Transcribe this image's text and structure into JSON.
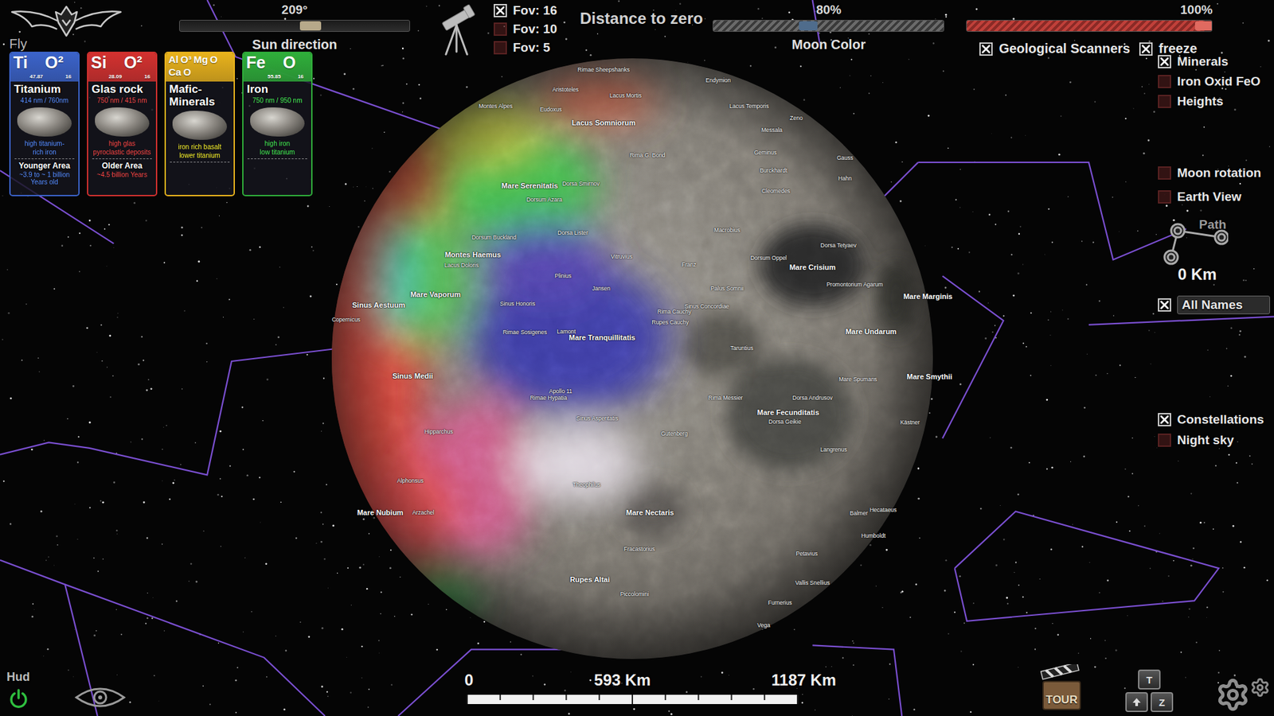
{
  "app": {
    "mode": "Fly"
  },
  "elements": [
    {
      "header": [
        {
          "text": "Ti",
          "kind": "symbol"
        },
        {
          "text": "47.87",
          "kind": "mass"
        },
        {
          "text": "O²",
          "kind": "symbol"
        },
        {
          "text": "16",
          "kind": "mass"
        }
      ],
      "title": "Titanium",
      "bands": "414 nm / 760nm",
      "notes": [
        "high titanium-",
        "rich iron"
      ],
      "age_title": "Younger Area",
      "age": "~3.9 to ~ 1 billion Years old",
      "color": "#3b63c9"
    },
    {
      "header": [
        {
          "text": "Si",
          "kind": "symbol"
        },
        {
          "text": "28.09",
          "kind": "mass"
        },
        {
          "text": "O²",
          "kind": "symbol"
        },
        {
          "text": "16",
          "kind": "mass"
        }
      ],
      "title": "Glas rock",
      "bands": "750 nm / 415 nm",
      "notes": [
        "high glas",
        "pyroclastic deposits"
      ],
      "age_title": "Older Area",
      "age": "~4.5 billion Years",
      "color": "#d3312f"
    },
    {
      "header": [
        {
          "text": "Al",
          "kind": "small"
        },
        {
          "text": "O³",
          "kind": "small"
        },
        {
          "text": "Mg",
          "kind": "small"
        },
        {
          "text": "O",
          "kind": "small"
        },
        {
          "text": "Ca",
          "kind": "small"
        },
        {
          "text": "O",
          "kind": "small"
        }
      ],
      "title": "Mafic-Minerals",
      "bands": "",
      "notes": [
        "iron rich basalt",
        "lower titanium"
      ],
      "age_title": "",
      "age": "",
      "color": "#e8b21c"
    },
    {
      "header": [
        {
          "text": "Fe",
          "kind": "symbol"
        },
        {
          "text": "55.85",
          "kind": "mass"
        },
        {
          "text": "O",
          "kind": "symbol"
        },
        {
          "text": "16",
          "kind": "mass"
        }
      ],
      "title": "Iron",
      "bands": "750 nm / 950 nm",
      "notes": [
        "high iron",
        "low titanium"
      ],
      "age_title": "",
      "age": "",
      "color": "#2fae3a"
    }
  ],
  "sun_slider": {
    "label": "Sun direction",
    "reading": "209°",
    "level": 0.57
  },
  "fov_options": [
    {
      "label": "Fov: 16",
      "selected": true
    },
    {
      "label": "Fov: 10",
      "selected": false
    },
    {
      "label": "Fov: 5",
      "selected": false
    }
  ],
  "distance_button": "Distance to zero",
  "moon_color": {
    "label": "Moon Color",
    "reading": "80%",
    "level": 0.41
  },
  "scanner_slider": {
    "reading": "100%",
    "level": 0.97
  },
  "scanners": [
    {
      "label": "Geological Scanners",
      "checked": true
    },
    {
      "label": "freeze",
      "checked": true
    }
  ],
  "layers": [
    {
      "label": "Minerals",
      "checked": true
    },
    {
      "label": "Iron Oxid FeO",
      "checked": false
    },
    {
      "label": "Heights",
      "checked": false
    }
  ],
  "view_options": [
    {
      "label": "Moon rotation",
      "checked": false
    },
    {
      "label": "Earth View",
      "checked": false
    }
  ],
  "path": {
    "label": "Path",
    "distance": "0 Km"
  },
  "names": {
    "label": "All Names",
    "checked": true
  },
  "sky_options": [
    {
      "label": "Constellations",
      "checked": true
    },
    {
      "label": "Night sky",
      "checked": false
    }
  ],
  "scale": {
    "labels": [
      "0",
      "593 Km",
      "1187 Km"
    ]
  },
  "hud": {
    "label": "Hud",
    "on": true
  },
  "tour": {
    "label": "TOUR"
  },
  "keys": [
    "T",
    "Z"
  ],
  "moon_labels": [
    {
      "text": "Mare Serenitatis",
      "kind": "mare"
    },
    {
      "text": "Mare Crisium",
      "kind": "mare"
    },
    {
      "text": "Mare Tranquillitatis",
      "kind": "mare"
    },
    {
      "text": "Mare Fecunditatis",
      "kind": "mare"
    },
    {
      "text": "Mare Nectaris",
      "kind": "mare"
    },
    {
      "text": "Mare Vaporum",
      "kind": "mare"
    },
    {
      "text": "Mare Nubium",
      "kind": "mare"
    },
    {
      "text": "Mare Marginis",
      "kind": "mare"
    },
    {
      "text": "Mare Smythii",
      "kind": "mare"
    },
    {
      "text": "Mare Undarum",
      "kind": "mare"
    },
    {
      "text": "Mare Spumans",
      "kind": "feature"
    },
    {
      "text": "Sinus Medii",
      "kind": "mare"
    },
    {
      "text": "Sinus Aestuum",
      "kind": "mare"
    },
    {
      "text": "Sinus Asperitatis",
      "kind": "feature"
    },
    {
      "text": "Sinus Concordiae",
      "kind": "feature"
    },
    {
      "text": "Lacus Somniorum",
      "kind": "mare"
    },
    {
      "text": "Montes Haemus",
      "kind": "mare"
    },
    {
      "text": "Rupes Altai",
      "kind": "mare"
    },
    {
      "text": "Copernicus",
      "kind": "feature"
    },
    {
      "text": "Lamont",
      "kind": "feature"
    },
    {
      "text": "Jansen",
      "kind": "feature"
    },
    {
      "text": "Dorsa Smirnov",
      "kind": "feature"
    },
    {
      "text": "Dorsum Azara",
      "kind": "feature"
    },
    {
      "text": "Rimae Sosigenes",
      "kind": "feature"
    },
    {
      "text": "Rimae Hypatia",
      "kind": "feature"
    },
    {
      "text": "Rima Messier",
      "kind": "feature"
    },
    {
      "text": "Dorsa Geikie",
      "kind": "feature"
    },
    {
      "text": "Dorsa Andrusov",
      "kind": "feature"
    },
    {
      "text": "Dorsum Oppel",
      "kind": "feature"
    },
    {
      "text": "Dorsa Tetyaev",
      "kind": "feature"
    },
    {
      "text": "Promontorium Agarum",
      "kind": "feature"
    },
    {
      "text": "Palus Somnii",
      "kind": "feature"
    },
    {
      "text": "Montes Alpes",
      "kind": "feature"
    },
    {
      "text": "Rima Cauchy",
      "kind": "feature"
    },
    {
      "text": "Rupes Cauchy",
      "kind": "feature"
    },
    {
      "text": "Lacus Temporis",
      "kind": "feature"
    },
    {
      "text": "Endymion",
      "kind": "feature"
    },
    {
      "text": "Rimae Sheepshanks",
      "kind": "feature"
    },
    {
      "text": "Aristoteles",
      "kind": "feature"
    },
    {
      "text": "Eudoxus",
      "kind": "feature"
    },
    {
      "text": "Lacus Mortis",
      "kind": "feature"
    },
    {
      "text": "Piccolomini",
      "kind": "feature"
    },
    {
      "text": "Fracastorius",
      "kind": "feature"
    },
    {
      "text": "Theophilus",
      "kind": "feature"
    },
    {
      "text": "Macrobius",
      "kind": "feature"
    },
    {
      "text": "Cleomedes",
      "kind": "feature"
    },
    {
      "text": "Langrenus",
      "kind": "feature"
    },
    {
      "text": "Petavius",
      "kind": "feature"
    },
    {
      "text": "Vallis Snellius",
      "kind": "feature"
    },
    {
      "text": "Furnerius",
      "kind": "feature"
    },
    {
      "text": "Vega",
      "kind": "feature"
    },
    {
      "text": "Taruntius",
      "kind": "feature"
    },
    {
      "text": "Gutenberg",
      "kind": "feature"
    },
    {
      "text": "Kästner",
      "kind": "feature"
    },
    {
      "text": "Hecataeus",
      "kind": "feature"
    },
    {
      "text": "Humboldt",
      "kind": "feature"
    },
    {
      "text": "Balmer",
      "kind": "feature"
    },
    {
      "text": "Dorsum Buckland",
      "kind": "feature"
    },
    {
      "text": "Lacus Doloris",
      "kind": "feature"
    },
    {
      "text": "Plinius",
      "kind": "feature"
    },
    {
      "text": "Dorsa Lister",
      "kind": "feature"
    },
    {
      "text": "Gauss",
      "kind": "feature"
    },
    {
      "text": "Hahn",
      "kind": "feature"
    },
    {
      "text": "Burckhardt",
      "kind": "feature"
    },
    {
      "text": "Geminus",
      "kind": "feature"
    },
    {
      "text": "Messala",
      "kind": "feature"
    },
    {
      "text": "Franz",
      "kind": "feature"
    },
    {
      "text": "Vitruvius",
      "kind": "feature"
    },
    {
      "text": "Apollo 11",
      "kind": "feature"
    },
    {
      "text": "Alphonsus",
      "kind": "feature"
    },
    {
      "text": "Arzachel",
      "kind": "feature"
    },
    {
      "text": "Hipparchus",
      "kind": "feature"
    },
    {
      "text": "Zeno",
      "kind": "feature"
    },
    {
      "text": "Rima G. Bond",
      "kind": "feature"
    },
    {
      "text": "Sinus Honoris",
      "kind": "feature"
    }
  ]
}
